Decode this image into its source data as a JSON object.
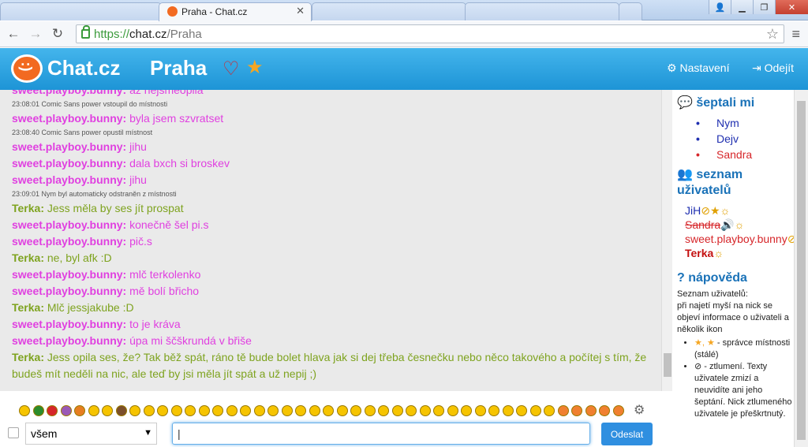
{
  "browser": {
    "tab_title": "Praha - Chat.cz",
    "url_scheme": "https://",
    "url_host": "chat.cz",
    "url_path": "/Praha"
  },
  "header": {
    "logo": "Chat.cz",
    "room": "Praha",
    "settings_label": "Nastavení",
    "logout_label": "Odejít"
  },
  "colors": {
    "pink_nick": "#e040e0",
    "green_nick": "#7ea31f",
    "header_blue": "#1d94d6"
  },
  "messages": [
    {
      "type": "msg",
      "nick": "sweet.playboy.bunny:",
      "text": "až nejsmeopila",
      "color": "#e040e0"
    },
    {
      "type": "sys",
      "text": "23:08:01 Comic Sans power vstoupil do místnosti"
    },
    {
      "type": "msg",
      "nick": "sweet.playboy.bunny:",
      "text": "byla jsem szvratset",
      "color": "#e040e0"
    },
    {
      "type": "sys",
      "text": "23:08:40 Comic Sans power opustil místnost"
    },
    {
      "type": "msg",
      "nick": "sweet.playboy.bunny:",
      "text": "jihu",
      "color": "#e040e0"
    },
    {
      "type": "msg",
      "nick": "sweet.playboy.bunny:",
      "text": "dala bxch si broskev",
      "color": "#e040e0"
    },
    {
      "type": "msg",
      "nick": "sweet.playboy.bunny:",
      "text": "jihu",
      "color": "#e040e0"
    },
    {
      "type": "sys",
      "text": "23:09:01 Nym byl automaticky odstraněn z místnosti"
    },
    {
      "type": "msg",
      "nick": "Terka:",
      "text": "Jess měla by ses jít prospat",
      "color": "#7ea31f"
    },
    {
      "type": "msg",
      "nick": "sweet.playboy.bunny:",
      "text": "konečně šel pi.s",
      "color": "#e040e0"
    },
    {
      "type": "msg",
      "nick": "sweet.playboy.bunny:",
      "text": "pič.s",
      "color": "#e040e0"
    },
    {
      "type": "msg",
      "nick": "Terka:",
      "text": "ne, byl afk :D",
      "color": "#7ea31f"
    },
    {
      "type": "msg",
      "nick": "sweet.playboy.bunny:",
      "text": "mlč terkolenko",
      "color": "#e040e0"
    },
    {
      "type": "msg",
      "nick": "sweet.playboy.bunny:",
      "text": "mě bolí břicho",
      "color": "#e040e0"
    },
    {
      "type": "msg",
      "nick": "Terka:",
      "text": "Mlč jessjakube :D",
      "color": "#7ea31f"
    },
    {
      "type": "msg",
      "nick": "sweet.playboy.bunny:",
      "text": "to je kráva",
      "color": "#e040e0"
    },
    {
      "type": "msg",
      "nick": "sweet.playboy.bunny:",
      "text": "úpa mi ščškrundá v břiše",
      "color": "#e040e0"
    },
    {
      "type": "msg",
      "nick": "Terka:",
      "text": "Jess opila ses, že? Tak běž spát, ráno tě bude bolet hlava jak si dej třeba česnečku nebo něco takového a počítej s tím, že budeš mít neděli na nic, ale teď by jsi měla jít spát a už nepij ;)",
      "color": "#7ea31f",
      "wrap": true
    }
  ],
  "sidebar": {
    "whispers_title": "šeptali mi",
    "whispers": [
      {
        "name": "Nym",
        "color": "#1f2fb0"
      },
      {
        "name": "Dejv",
        "color": "#1f2fb0"
      },
      {
        "name": "Sandra",
        "color": "#d6262a"
      }
    ],
    "users_title": "seznam uživatelů",
    "users": [
      {
        "name": "JiH",
        "color": "#1f2fb0",
        "strike": false,
        "bold": false,
        "badges": "⊘★☼"
      },
      {
        "name": "Sandra",
        "color": "#d6262a",
        "strike": true,
        "bold": false,
        "badges": "🔊☼"
      },
      {
        "name": "sweet.playboy.bunny",
        "color": "#d6262a",
        "strike": false,
        "bold": false,
        "badges": "⊘"
      },
      {
        "name": "Terka",
        "color": "#c41010",
        "strike": false,
        "bold": true,
        "badges": "☼"
      }
    ],
    "help_title": "nápověda",
    "help_intro": "Seznam uživatelů:",
    "help_text": "při najetí myší na nick se objeví informace o uživateli a několik ikon",
    "help_items": [
      "- správce místnosti (stálé)",
      "- ztlumení. Texty uživatele zmizí a neuvidíte ani jeho šeptání. Nick ztlumeného uživatele je přeškrtnutý."
    ]
  },
  "composer": {
    "recipient": "všem",
    "message_value": "",
    "send_label": "Odeslat"
  }
}
